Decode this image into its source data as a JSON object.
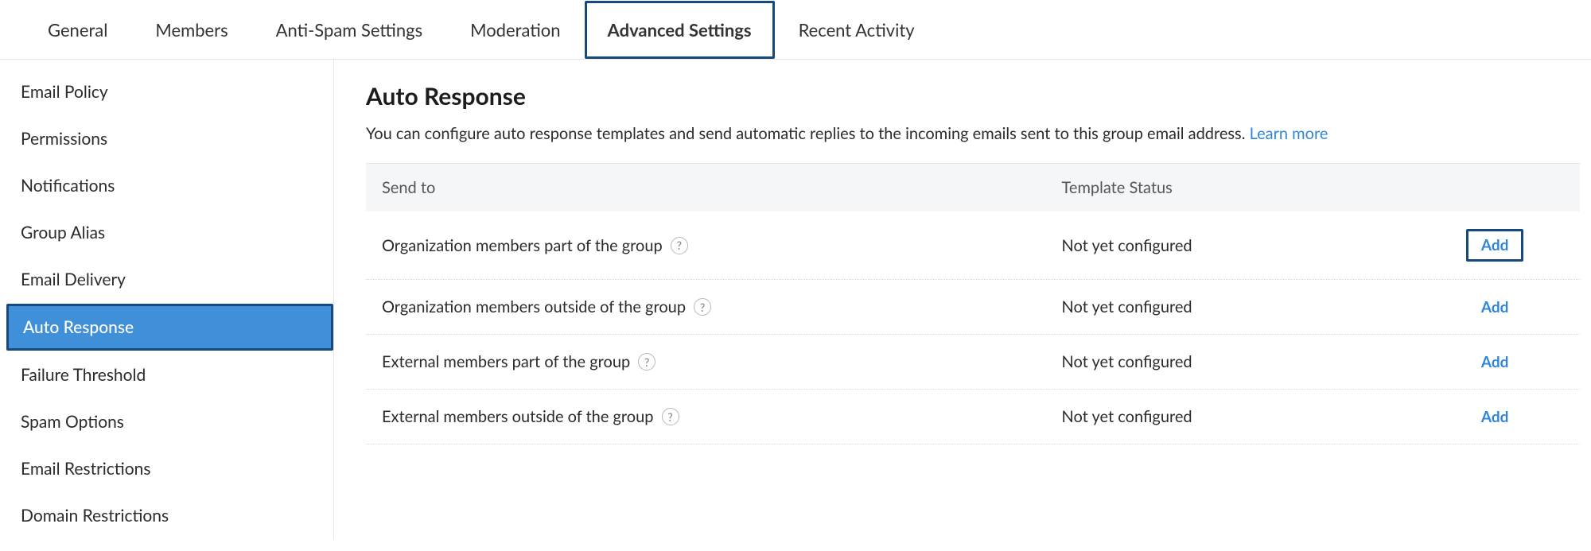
{
  "topTabs": {
    "items": [
      {
        "label": "General",
        "active": false
      },
      {
        "label": "Members",
        "active": false
      },
      {
        "label": "Anti-Spam Settings",
        "active": false
      },
      {
        "label": "Moderation",
        "active": false
      },
      {
        "label": "Advanced Settings",
        "active": true
      },
      {
        "label": "Recent Activity",
        "active": false
      }
    ]
  },
  "sidebar": {
    "items": [
      {
        "label": "Email Policy",
        "active": false
      },
      {
        "label": "Permissions",
        "active": false
      },
      {
        "label": "Notifications",
        "active": false
      },
      {
        "label": "Group Alias",
        "active": false
      },
      {
        "label": "Email Delivery",
        "active": false
      },
      {
        "label": "Auto Response",
        "active": true
      },
      {
        "label": "Failure Threshold",
        "active": false
      },
      {
        "label": "Spam Options",
        "active": false
      },
      {
        "label": "Email Restrictions",
        "active": false
      },
      {
        "label": "Domain Restrictions",
        "active": false
      }
    ]
  },
  "main": {
    "title": "Auto Response",
    "description": "You can configure auto response templates and send automatic replies to the incoming emails sent to this group email address. ",
    "learnMore": "Learn more"
  },
  "table": {
    "headers": {
      "sendTo": "Send to",
      "status": "Template Status"
    },
    "addLabel": "Add",
    "rows": [
      {
        "sendTo": "Organization members part of the group",
        "status": "Not yet configured",
        "highlight": true
      },
      {
        "sendTo": "Organization members outside of the group",
        "status": "Not yet configured",
        "highlight": false
      },
      {
        "sendTo": "External members part of the group",
        "status": "Not yet configured",
        "highlight": false
      },
      {
        "sendTo": "External members outside of the group",
        "status": "Not yet configured",
        "highlight": false
      }
    ]
  },
  "glyphs": {
    "questionMark": "?"
  }
}
